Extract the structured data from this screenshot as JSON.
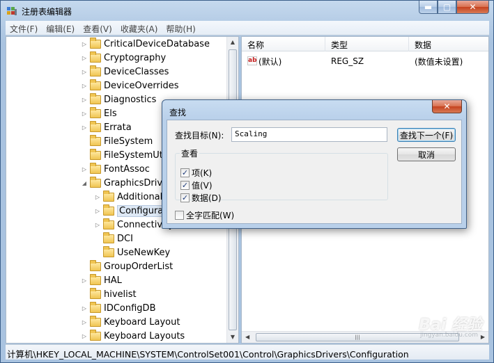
{
  "window": {
    "title": "注册表编辑器",
    "controls": {
      "minimize": "▬",
      "maximize": "▢",
      "close": "✕"
    }
  },
  "menu": [
    {
      "label": "文件(F)"
    },
    {
      "label": "编辑(E)"
    },
    {
      "label": "查看(V)"
    },
    {
      "label": "收藏夹(A)"
    },
    {
      "label": "帮助(H)"
    }
  ],
  "tree": {
    "items": [
      {
        "label": "CriticalDeviceDatabase",
        "expand": "▷"
      },
      {
        "label": "Cryptography",
        "expand": "▷"
      },
      {
        "label": "DeviceClasses",
        "expand": "▷"
      },
      {
        "label": "DeviceOverrides",
        "expand": "▷"
      },
      {
        "label": "Diagnostics",
        "expand": "▷"
      },
      {
        "label": "Els",
        "expand": "▷"
      },
      {
        "label": "Errata",
        "expand": "▷"
      },
      {
        "label": "FileSystem",
        "expand": ""
      },
      {
        "label": "FileSystemUtilities",
        "expand": ""
      },
      {
        "label": "FontAssoc",
        "expand": "▷"
      },
      {
        "label": "GraphicsDrivers",
        "expand": "◢"
      },
      {
        "label": "AdditionalModeLists",
        "expand": "▷"
      },
      {
        "label": "Configuration",
        "expand": "▷"
      },
      {
        "label": "Connectivity",
        "expand": "▷"
      },
      {
        "label": "DCI",
        "expand": ""
      },
      {
        "label": "UseNewKey",
        "expand": ""
      },
      {
        "label": "GroupOrderList",
        "expand": ""
      },
      {
        "label": "HAL",
        "expand": "▷"
      },
      {
        "label": "hivelist",
        "expand": ""
      },
      {
        "label": "IDConfigDB",
        "expand": "▷"
      },
      {
        "label": "Keyboard Layout",
        "expand": "▷"
      },
      {
        "label": "Keyboard Layouts",
        "expand": "▷"
      }
    ]
  },
  "values": {
    "columns": [
      "名称",
      "类型",
      "数据"
    ],
    "rows": [
      {
        "icon": "ab",
        "name": "(默认)",
        "type": "REG_SZ",
        "data": "(数值未设置)"
      }
    ]
  },
  "status": "计算机\\HKEY_LOCAL_MACHINE\\SYSTEM\\ControlSet001\\Control\\GraphicsDrivers\\Configuration",
  "find_dialog": {
    "title": "查找",
    "target_label": "查找目标(N):",
    "target_value": "Scaling",
    "find_next": "查找下一个(F)",
    "cancel": "取消",
    "look_at": "查看",
    "options": [
      {
        "label": "项(K)",
        "checked": true
      },
      {
        "label": "值(V)",
        "checked": true
      },
      {
        "label": "数据(D)",
        "checked": true
      }
    ],
    "match_whole": {
      "label": "全字匹配(W)",
      "checked": false
    }
  },
  "watermark": {
    "text": "Bai 经验",
    "sub": "jingyan.baidu.com"
  },
  "colors": {
    "title_gradient": "#b9d0ea",
    "close_red": "#c5421f",
    "folder": "#f0c552",
    "selection": "#dde8f5"
  }
}
